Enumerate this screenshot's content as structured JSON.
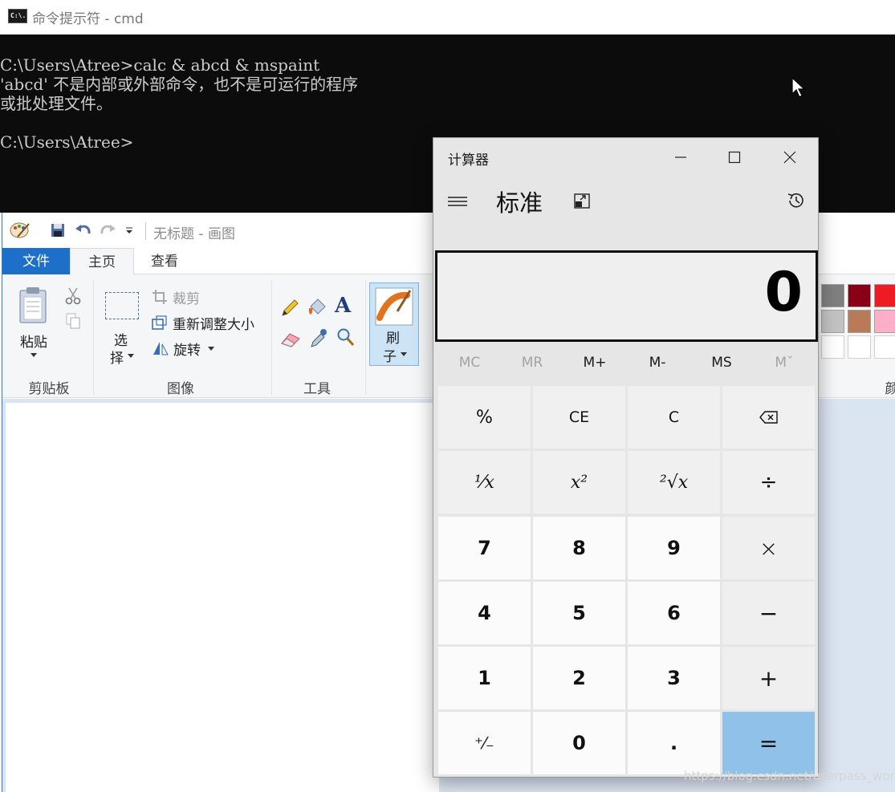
{
  "cmd": {
    "title": "命令提示符 - cmd",
    "icon_text": "C:\\.",
    "lines": [
      "C:\\Users\\Atree>calc & abcd & mspaint",
      "'abcd' 不是内部或外部命令，也不是可运行的程序",
      "或批处理文件。",
      "",
      "C:\\Users\\Atree>"
    ]
  },
  "paint": {
    "title": "无标题 - 画图",
    "tabs": [
      "文件",
      "主页",
      "查看"
    ],
    "clipboard": {
      "paste": "粘贴",
      "group": "剪贴板"
    },
    "image": {
      "select_top": "选",
      "select_bottom": "择",
      "crop": "裁剪",
      "resize": "重新调整大小",
      "rotate": "旋转",
      "group": "图像"
    },
    "tools": {
      "group": "工具"
    },
    "brush": {
      "top": "刷",
      "bottom": "子"
    },
    "colors_group_partial": "颜",
    "palette_row1": [
      "#7f7f7f",
      "#880015",
      "#ed1c24"
    ],
    "palette_row2": [
      "#c3c3c3",
      "#b97a57",
      "#ffaec9"
    ]
  },
  "calc": {
    "title": "计算器",
    "mode": "标准",
    "display": "0",
    "memory": [
      "MC",
      "MR",
      "M+",
      "M-",
      "MS",
      "Mˇ"
    ],
    "keys": {
      "percent": "%",
      "ce": "CE",
      "c": "C",
      "backspace": "⌫",
      "reciprocal": "¹⁄x",
      "square": "x²",
      "sqrt": "²√x",
      "divide": "÷",
      "n7": "7",
      "n8": "8",
      "n9": "9",
      "multiply": "×",
      "n4": "4",
      "n5": "5",
      "n6": "6",
      "minus": "−",
      "n1": "1",
      "n2": "2",
      "n3": "3",
      "plus": "+",
      "negate": "⁺⁄₋",
      "n0": "0",
      "decimal": ".",
      "equals": "="
    }
  },
  "watermark": "https://blog.csdn.net/userpass_word"
}
